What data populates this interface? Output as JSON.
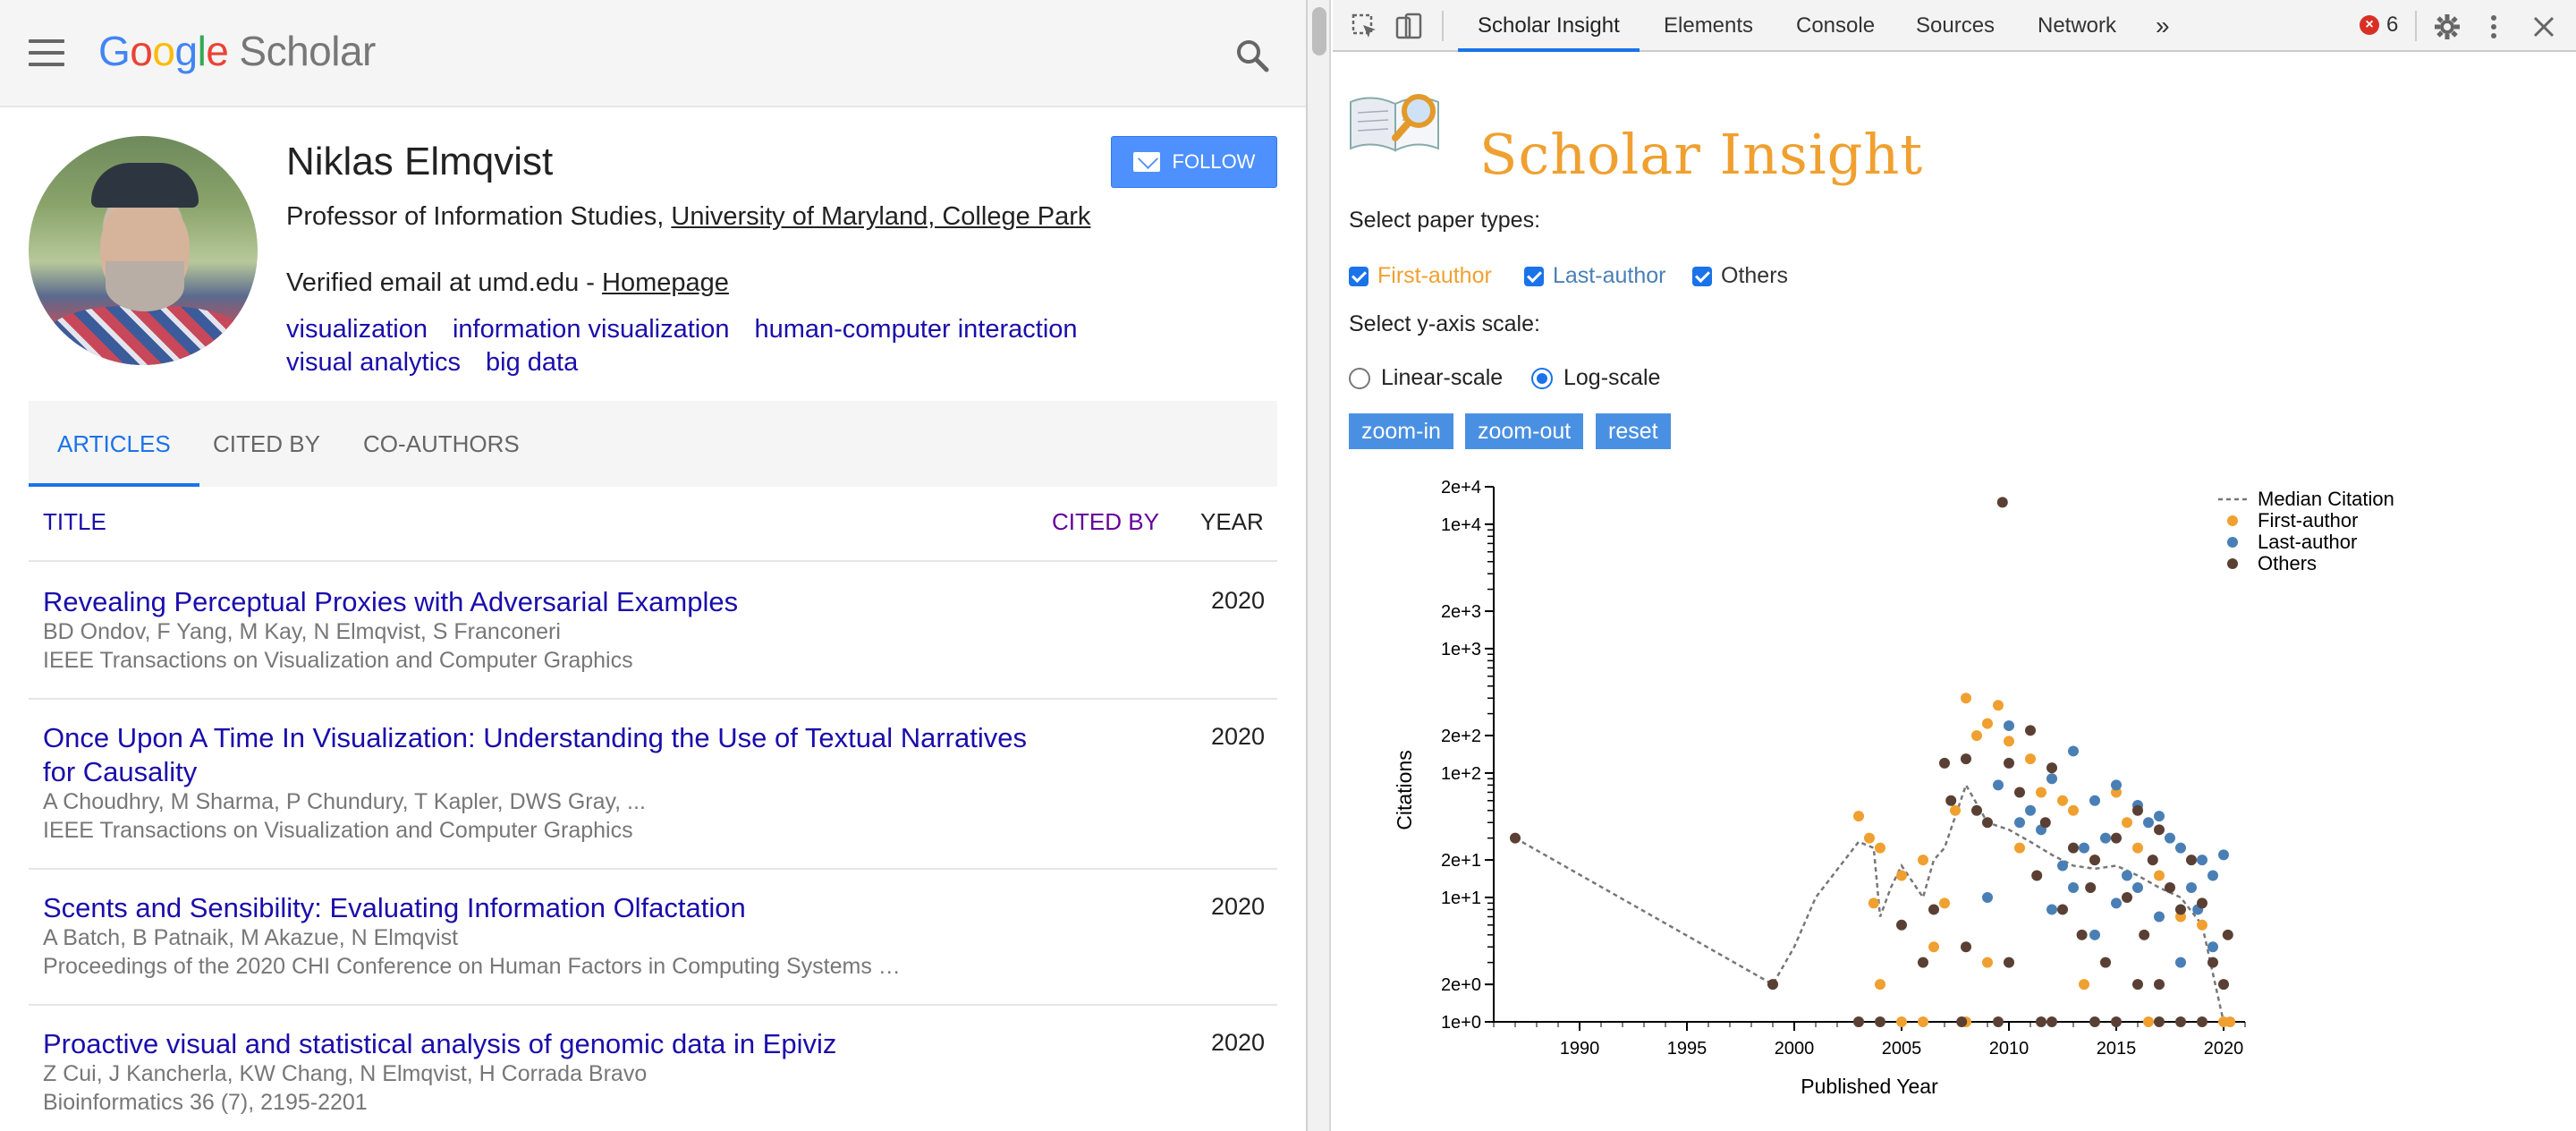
{
  "scholar": {
    "logo_google": [
      "G",
      "o",
      "o",
      "g",
      "l",
      "e"
    ],
    "logo_scholar": "Scholar",
    "profile": {
      "name": "Niklas Elmqvist",
      "affiliation_prefix": "Professor of Information Studies, ",
      "affiliation_link": "University of Maryland, College Park",
      "email_prefix": "Verified email at umd.edu - ",
      "homepage_label": "Homepage",
      "interests": [
        "visualization",
        "information visualization",
        "human-computer interaction",
        "visual analytics",
        "big data"
      ],
      "follow_label": "FOLLOW"
    },
    "tabs": [
      "ARTICLES",
      "CITED BY",
      "CO-AUTHORS"
    ],
    "table_header": {
      "title": "TITLE",
      "cited_by": "CITED BY",
      "year": "YEAR"
    },
    "articles": [
      {
        "title": "Revealing Perceptual Proxies with Adversarial Examples",
        "authors": "BD Ondov, F Yang, M Kay, N Elmqvist, S Franconeri",
        "venue": "IEEE Transactions on Visualization and Computer Graphics",
        "year": "2020"
      },
      {
        "title": "Once Upon A Time In Visualization: Understanding the Use of Textual Narratives for Causality",
        "authors": "A Choudhry, M Sharma, P Chundury, T Kapler, DWS Gray, ...",
        "venue": "IEEE Transactions on Visualization and Computer Graphics",
        "year": "2020"
      },
      {
        "title": "Scents and Sensibility: Evaluating Information Olfactation",
        "authors": "A Batch, B Patnaik, M Akazue, N Elmqvist",
        "venue": "Proceedings of the 2020 CHI Conference on Human Factors in Computing Systems …",
        "year": "2020"
      },
      {
        "title": "Proactive visual and statistical analysis of genomic data in Epiviz",
        "authors": "Z Cui, J Kancherla, KW Chang, N Elmqvist, H Corrada Bravo",
        "venue": "Bioinformatics 36 (7), 2195-2201",
        "year": "2020"
      }
    ]
  },
  "devtools": {
    "tabs": [
      "Scholar Insight",
      "Elements",
      "Console",
      "Sources",
      "Network"
    ],
    "more_icon": "»",
    "error_count": "6",
    "error_icon": "×"
  },
  "insight": {
    "title": "Scholar Insight",
    "paper_types_label": "Select paper types:",
    "paper_types": [
      {
        "label": "First-author",
        "color": "#f0a030",
        "checked": true
      },
      {
        "label": "Last-author",
        "color": "#4a7fb5",
        "checked": true
      },
      {
        "label": "Others",
        "color": "#333333",
        "checked": true
      }
    ],
    "scale_label": "Select y-axis scale:",
    "scales": [
      {
        "label": "Linear-scale",
        "selected": false
      },
      {
        "label": "Log-scale",
        "selected": true
      }
    ],
    "buttons": [
      "zoom-in",
      "zoom-out",
      "reset"
    ]
  },
  "chart_data": {
    "type": "scatter",
    "xlabel": "Published Year",
    "ylabel": "Citations",
    "log_scale": true,
    "xlim": [
      1986,
      2021
    ],
    "ylim": [
      1,
      20000
    ],
    "x_ticks": [
      "1990",
      "1995",
      "2000",
      "2005",
      "2010",
      "2015",
      "2020"
    ],
    "x_tick_values": [
      1990,
      1995,
      2000,
      2005,
      2010,
      2015,
      2020
    ],
    "y_tick_labels": [
      "1e+0",
      "2e+0",
      "1e+1",
      "2e+1",
      "1e+2",
      "2e+2",
      "1e+3",
      "2e+3",
      "1e+4",
      "2e+4"
    ],
    "y_tick_values": [
      1,
      2,
      10,
      20,
      100,
      200,
      1000,
      2000,
      10000,
      20000
    ],
    "colors": {
      "First-author": "#f0a030",
      "Last-author": "#4a7fb5",
      "Others": "#5a4034",
      "median": "#777777"
    },
    "legend": [
      "Median Citation",
      "First-author",
      "Last-author",
      "Others"
    ],
    "legend_position": "top-right",
    "median": {
      "x": [
        1987,
        1999,
        2000,
        2001,
        2003,
        2003.7,
        2004,
        2004.5,
        2005,
        2006,
        2006.5,
        2007,
        2008,
        2009,
        2010,
        2011,
        2012,
        2013,
        2014,
        2015,
        2016,
        2017,
        2018,
        2019,
        2020
      ],
      "y": [
        30,
        2,
        4,
        10,
        28,
        25,
        7,
        12,
        18,
        10,
        20,
        25,
        80,
        40,
        35,
        28,
        22,
        18,
        17,
        18,
        15,
        12,
        10,
        6,
        1
      ]
    },
    "series": [
      {
        "name": "First-author",
        "points": [
          [
            2003,
            45
          ],
          [
            2004,
            25
          ],
          [
            2003.5,
            30
          ],
          [
            2003.7,
            9
          ],
          [
            2004,
            2
          ],
          [
            2005,
            15
          ],
          [
            2006,
            20
          ],
          [
            2006.5,
            4
          ],
          [
            2007,
            9
          ],
          [
            2007.5,
            50
          ],
          [
            2008,
            400
          ],
          [
            2008.5,
            200
          ],
          [
            2009,
            250
          ],
          [
            2009.5,
            350
          ],
          [
            2010,
            180
          ],
          [
            2010.5,
            25
          ],
          [
            2011,
            130
          ],
          [
            2011.5,
            70
          ],
          [
            2012,
            90
          ],
          [
            2012.5,
            60
          ],
          [
            2013,
            50
          ],
          [
            2014,
            20
          ],
          [
            2015,
            70
          ],
          [
            2015.5,
            40
          ],
          [
            2016,
            25
          ],
          [
            2017,
            15
          ],
          [
            2018,
            7
          ],
          [
            2019,
            6
          ],
          [
            2020,
            1
          ],
          [
            2003,
            1
          ],
          [
            2005,
            1
          ],
          [
            2006,
            1
          ],
          [
            2008,
            1
          ],
          [
            2009,
            3
          ],
          [
            2013.5,
            2
          ],
          [
            2016.5,
            1
          ],
          [
            2020.3,
            1
          ]
        ]
      },
      {
        "name": "Last-author",
        "points": [
          [
            2009,
            10
          ],
          [
            2009.5,
            80
          ],
          [
            2010,
            240
          ],
          [
            2011,
            50
          ],
          [
            2011.5,
            35
          ],
          [
            2012,
            90
          ],
          [
            2012.5,
            18
          ],
          [
            2013,
            150
          ],
          [
            2013.5,
            25
          ],
          [
            2014,
            60
          ],
          [
            2014.5,
            30
          ],
          [
            2015,
            80
          ],
          [
            2015.5,
            15
          ],
          [
            2016,
            55
          ],
          [
            2016.5,
            40
          ],
          [
            2017,
            45
          ],
          [
            2017.5,
            30
          ],
          [
            2018,
            25
          ],
          [
            2018.5,
            12
          ],
          [
            2019,
            20
          ],
          [
            2019.5,
            15
          ],
          [
            2020,
            22
          ],
          [
            2014,
            5
          ],
          [
            2015,
            9
          ],
          [
            2016,
            12
          ],
          [
            2017,
            7
          ],
          [
            2018,
            3
          ],
          [
            2012,
            8
          ],
          [
            2013,
            12
          ],
          [
            2010.5,
            40
          ],
          [
            2019.5,
            4
          ],
          [
            2018.8,
            8
          ]
        ]
      },
      {
        "name": "Others",
        "points": [
          [
            1987,
            30
          ],
          [
            1999,
            2
          ],
          [
            2003,
            1
          ],
          [
            2004,
            1
          ],
          [
            2005,
            6
          ],
          [
            2006,
            3
          ],
          [
            2006.5,
            8
          ],
          [
            2007,
            120
          ],
          [
            2007.3,
            60
          ],
          [
            2008,
            130
          ],
          [
            2008.5,
            50
          ],
          [
            2009,
            40
          ],
          [
            2009.7,
            15000
          ],
          [
            2010,
            120
          ],
          [
            2010.5,
            70
          ],
          [
            2011,
            220
          ],
          [
            2011.3,
            15
          ],
          [
            2011.7,
            40
          ],
          [
            2012,
            110
          ],
          [
            2012.5,
            8
          ],
          [
            2013,
            25
          ],
          [
            2013.4,
            5
          ],
          [
            2013.8,
            12
          ],
          [
            2014,
            20
          ],
          [
            2014.5,
            3
          ],
          [
            2015,
            30
          ],
          [
            2015.5,
            10
          ],
          [
            2016,
            50
          ],
          [
            2016.3,
            5
          ],
          [
            2016.7,
            20
          ],
          [
            2017,
            35
          ],
          [
            2017.5,
            12
          ],
          [
            2018,
            8
          ],
          [
            2018.5,
            20
          ],
          [
            2019,
            9
          ],
          [
            2019.5,
            3
          ],
          [
            2020,
            2
          ],
          [
            2020.2,
            5
          ],
          [
            2008,
            4
          ],
          [
            2010,
            3
          ],
          [
            2012,
            1
          ],
          [
            2014,
            1
          ],
          [
            2015,
            1
          ],
          [
            2016,
            2
          ],
          [
            2017,
            1
          ],
          [
            2017,
            2
          ],
          [
            2018,
            1
          ],
          [
            2019,
            1
          ],
          [
            2007.8,
            1
          ],
          [
            2009.5,
            1
          ],
          [
            2011.5,
            1
          ]
        ]
      }
    ]
  }
}
